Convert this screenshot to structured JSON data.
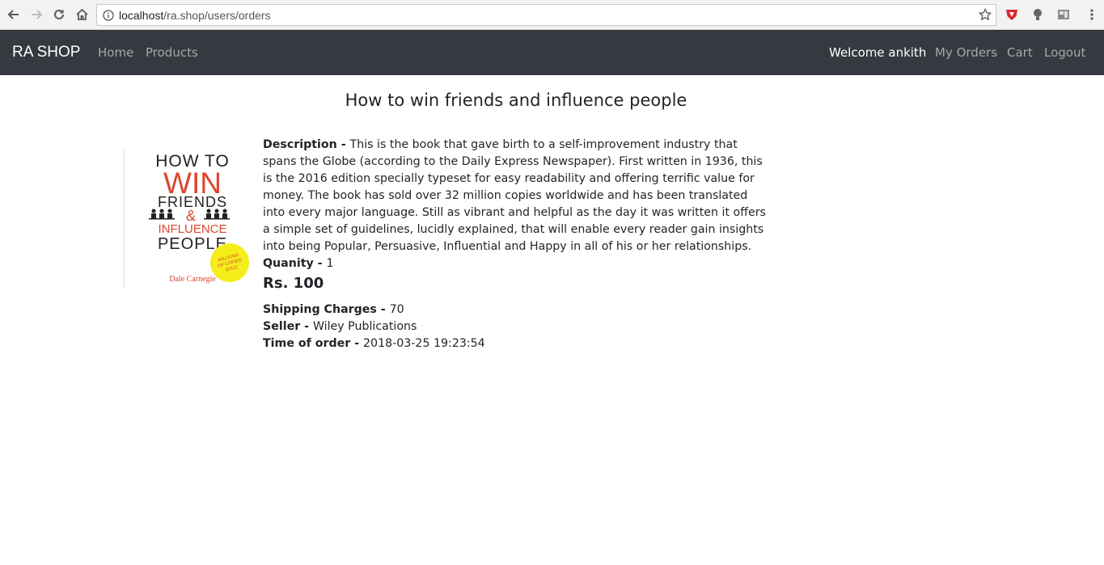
{
  "browser": {
    "url_host": "localhost",
    "url_path": "/ra.shop/users/orders"
  },
  "navbar": {
    "brand": "RA SHOP",
    "links": [
      "Home",
      "Products"
    ],
    "welcome": "Welcome ankith",
    "right_links": [
      "My Orders",
      "Cart",
      "Logout"
    ]
  },
  "order": {
    "title": "How to win friends and influence people",
    "description_label": "Description - ",
    "description": "This is the book that gave birth to a self-improvement industry that spans the Globe (according to the Daily Express Newspaper). First written in 1936, this is the 2016 edition specially typeset for easy readability and offering terrific value for money. The book has sold over 32 million copies worldwide and has been translated into every major language. Still as vibrant and helpful as the day it was written it offers a simple set of guidelines, lucidly explained, that will enable every reader gain insights into being Popular, Persuasive, Influential and Happy in all of his or her relationships.",
    "quantity_label": "Quanity - ",
    "quantity": "1",
    "price": "Rs. 100",
    "shipping_label": "Shipping Charges - ",
    "shipping": "70",
    "seller_label": "Seller - ",
    "seller": "Wiley Publications",
    "time_label": "Time of order - ",
    "time": "2018-03-25 19:23:54"
  },
  "cover": {
    "line1": "HOW TO",
    "line2": "WIN",
    "line3": "FRIENDS",
    "line4": "&",
    "line5": "INFLUENCE",
    "line6": "PEOPLE",
    "badge1": "MILLIONS",
    "badge2": "OF COPIES",
    "badge3": "SOLD",
    "author": "Dale Carnegie"
  },
  "colors": {
    "navbar_bg": "#343a40",
    "cover_red": "#d9472f",
    "badge_yellow": "#f4ee1b"
  }
}
